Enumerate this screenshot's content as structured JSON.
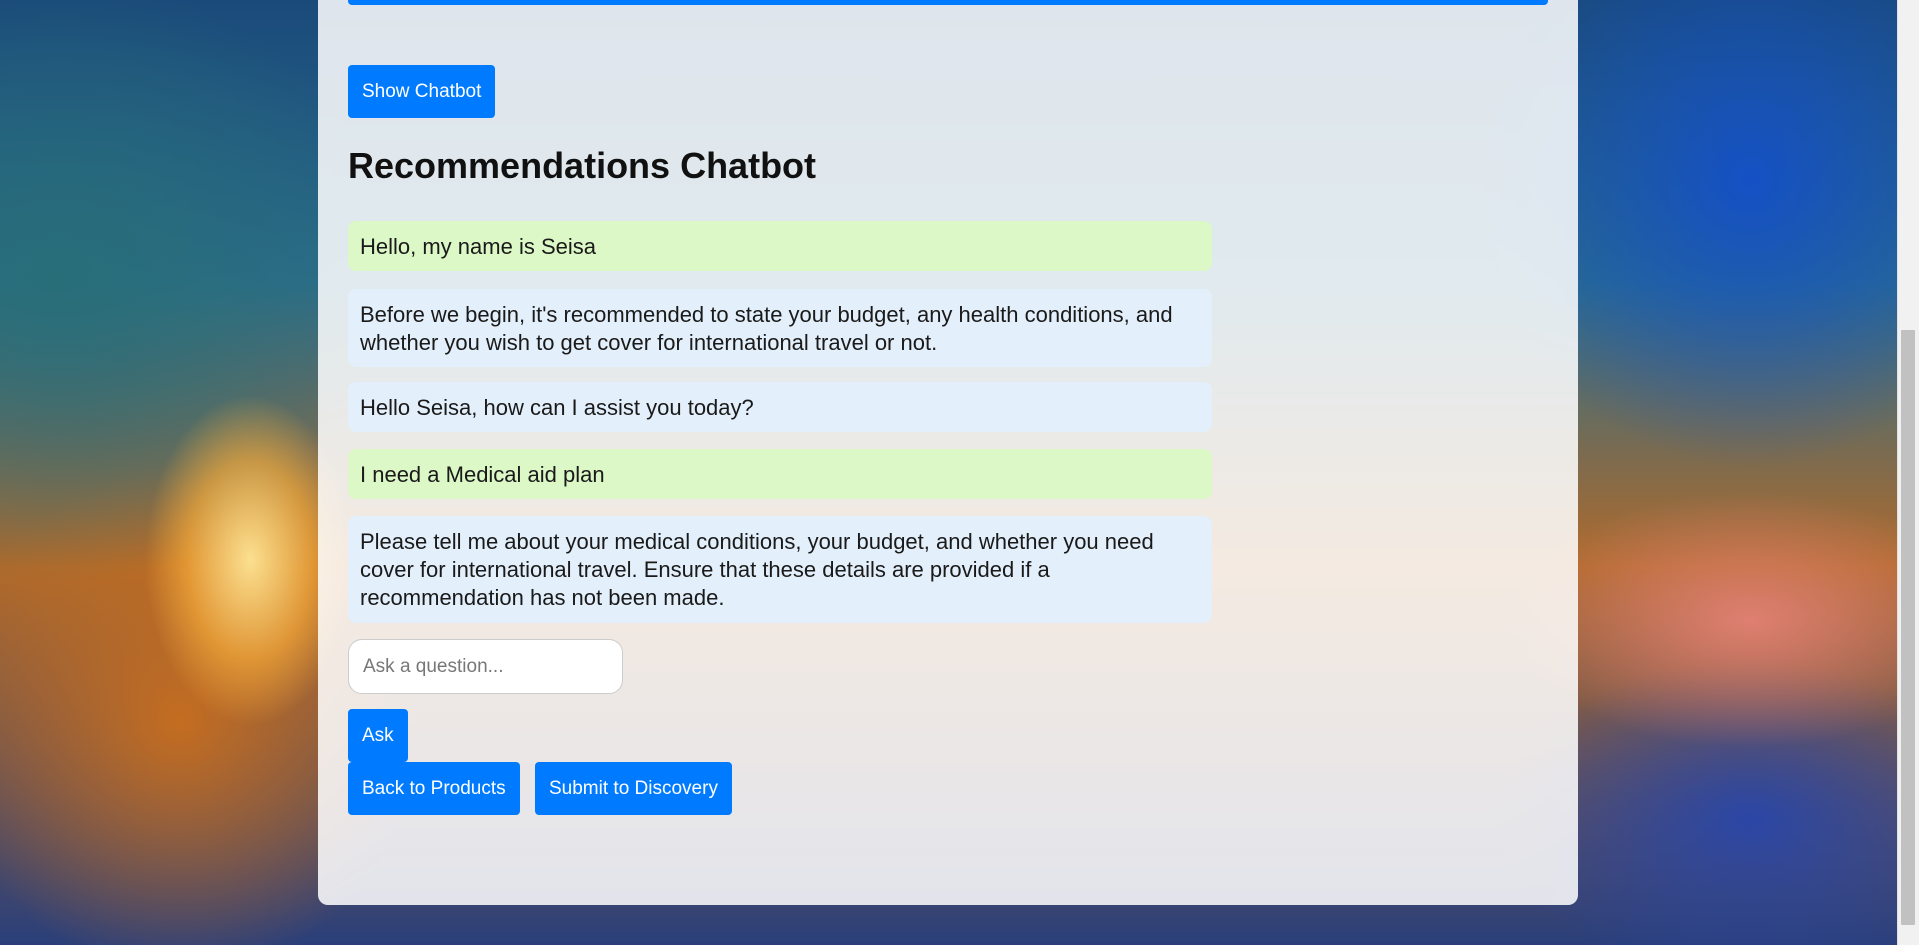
{
  "header": {
    "show_chatbot_label": "Show Chatbot",
    "title": "Recommendations Chatbot"
  },
  "chat": {
    "messages": [
      {
        "role": "user",
        "text": "Hello, my name is Seisa"
      },
      {
        "role": "bot",
        "text": "Before we begin, it's recommended to state your budget, any health conditions, and whether you wish to get cover for international travel or not."
      },
      {
        "role": "bot",
        "text": "Hello Seisa, how can I assist you today?"
      },
      {
        "role": "user",
        "text": "I need a Medical aid plan"
      },
      {
        "role": "bot",
        "text": "Please tell me about your medical conditions, your budget, and whether you need cover for international travel. Ensure that these details are provided if a recommendation has not been made."
      }
    ],
    "input_placeholder": "Ask a question...",
    "input_value": "",
    "ask_label": "Ask"
  },
  "footer": {
    "back_label": "Back to Products",
    "submit_label": "Submit to Discovery"
  },
  "colors": {
    "accent": "#007bff",
    "user_bubble": "#dcf8c6",
    "bot_bubble": "#e3effa"
  }
}
